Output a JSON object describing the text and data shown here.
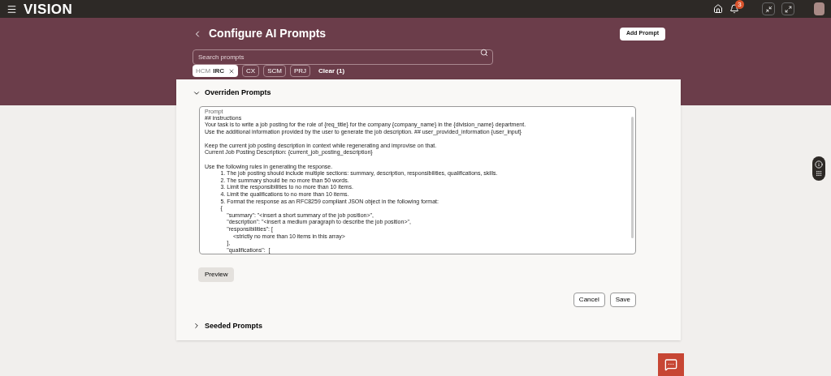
{
  "header": {
    "logo": "VISION",
    "notification_count": "3"
  },
  "page": {
    "title": "Configure AI Prompts",
    "add_button": "Add Prompt"
  },
  "search": {
    "placeholder": "Search prompts"
  },
  "filters": [
    {
      "label": "HCM",
      "sublabel": "IRC",
      "selected": true
    },
    {
      "label": "CX",
      "selected": false
    },
    {
      "label": "SCM",
      "selected": false
    },
    {
      "label": "PRJ",
      "selected": false
    }
  ],
  "clear_label": "Clear (1)",
  "sections": [
    {
      "title": "Overriden Prompts",
      "expanded": true
    },
    {
      "title": "Seeded Prompts",
      "expanded": false
    }
  ],
  "prompt": {
    "label": "Prompt",
    "value": "## instructions\nYour task is to write a job posting for the role of {req_title} for the company {company_name} in the {division_name} department.\nUse the additional information provided by the user to generate the job description. ## user_provided_information {user_input}\n\nKeep the current job posting description in context while regenerating and improvise on that.\nCurrent Job Posting Description: {current_job_posting_description}\n\nUse the following rules in generating the response.\n          1. The job posting should include multiple sections: summary, description, responsibilities, qualifications, skills.\n          2. The summary should be no more than 50 words.\n          3. Limit the responsibilities to no more than 10 items.\n          4. Limit the qualifications to no more than 10 items.\n          5. Format the response as an RFC8259 compliant JSON object in the following format:\n          {\n              \"summary\": \"<insert a short summary of the job position>\",\n              \"description\": \"<insert a medium paragraph to describe the job position>\",\n              \"responsibilities\": [\n                  <strictly no more than 10 items in this array>\n              ],\n              \"qualifications\":  ["
  },
  "buttons": {
    "preview": "Preview",
    "cancel": "Cancel",
    "save": "Save"
  }
}
